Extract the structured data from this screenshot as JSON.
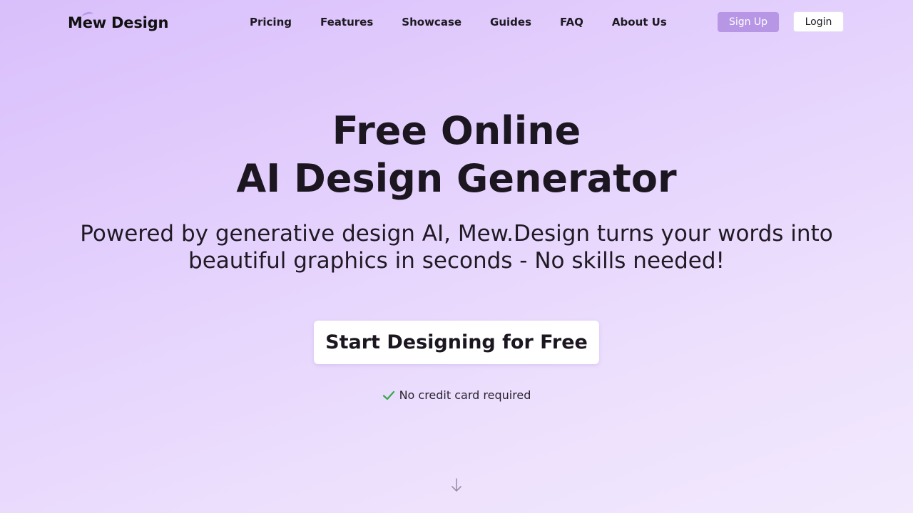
{
  "brand": {
    "name": "Mew Design"
  },
  "nav": {
    "links": [
      "Pricing",
      "Features",
      "Showcase",
      "Guides",
      "FAQ",
      "About Us"
    ],
    "signup_label": "Sign Up",
    "login_label": "Login"
  },
  "hero": {
    "title_line1": "Free Online",
    "title_line2": "AI Design Generator",
    "subtitle": "Powered by generative design AI, Mew.Design turns your words into beautiful graphics in seconds - No skills needed!",
    "cta_label": "Start Designing for Free",
    "note": "No credit card required"
  },
  "icons": {
    "note_icon": "check-icon",
    "scroll_icon": "arrow-down-icon"
  },
  "colors": {
    "accent": "#b796e6",
    "check": "#3aa64a",
    "background_start": "#d9bffb",
    "background_end": "#f2e9fd"
  }
}
